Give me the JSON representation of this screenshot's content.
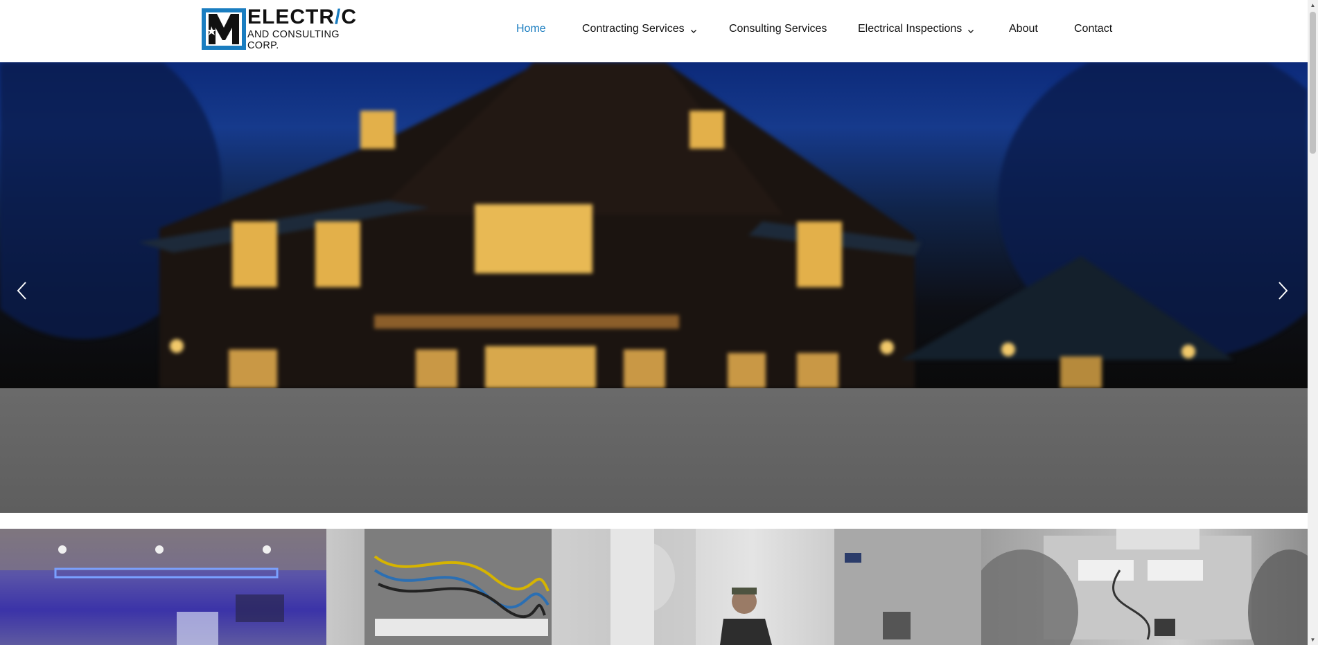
{
  "logo": {
    "line1_prefix": "ELECTR",
    "line1_bolt": "/",
    "line1_suffix": "C",
    "line2": "AND CONSULTING CORP.",
    "brand_color": "#1a7dc0"
  },
  "nav": {
    "items": [
      {
        "label": "Home",
        "active": true,
        "has_dropdown": false
      },
      {
        "label": "Contracting Services",
        "active": false,
        "has_dropdown": true
      },
      {
        "label": "Consulting Services",
        "active": false,
        "has_dropdown": false
      },
      {
        "label": "Electrical Inspections",
        "active": false,
        "has_dropdown": true
      },
      {
        "label": "About",
        "active": false,
        "has_dropdown": false
      },
      {
        "label": "Contact",
        "active": false,
        "has_dropdown": false
      }
    ],
    "active_color": "#1a7dc0"
  },
  "hero": {
    "prev_icon": "chevron-left-icon",
    "next_icon": "chevron-right-icon"
  },
  "gallery": {
    "tiles": [
      {
        "image": "event-stage-photo"
      },
      {
        "image": "electrical-panel-wiring-photo"
      },
      {
        "image": "electrician-worker-photo"
      },
      {
        "image": "control-panel-inspection-photo"
      }
    ]
  }
}
